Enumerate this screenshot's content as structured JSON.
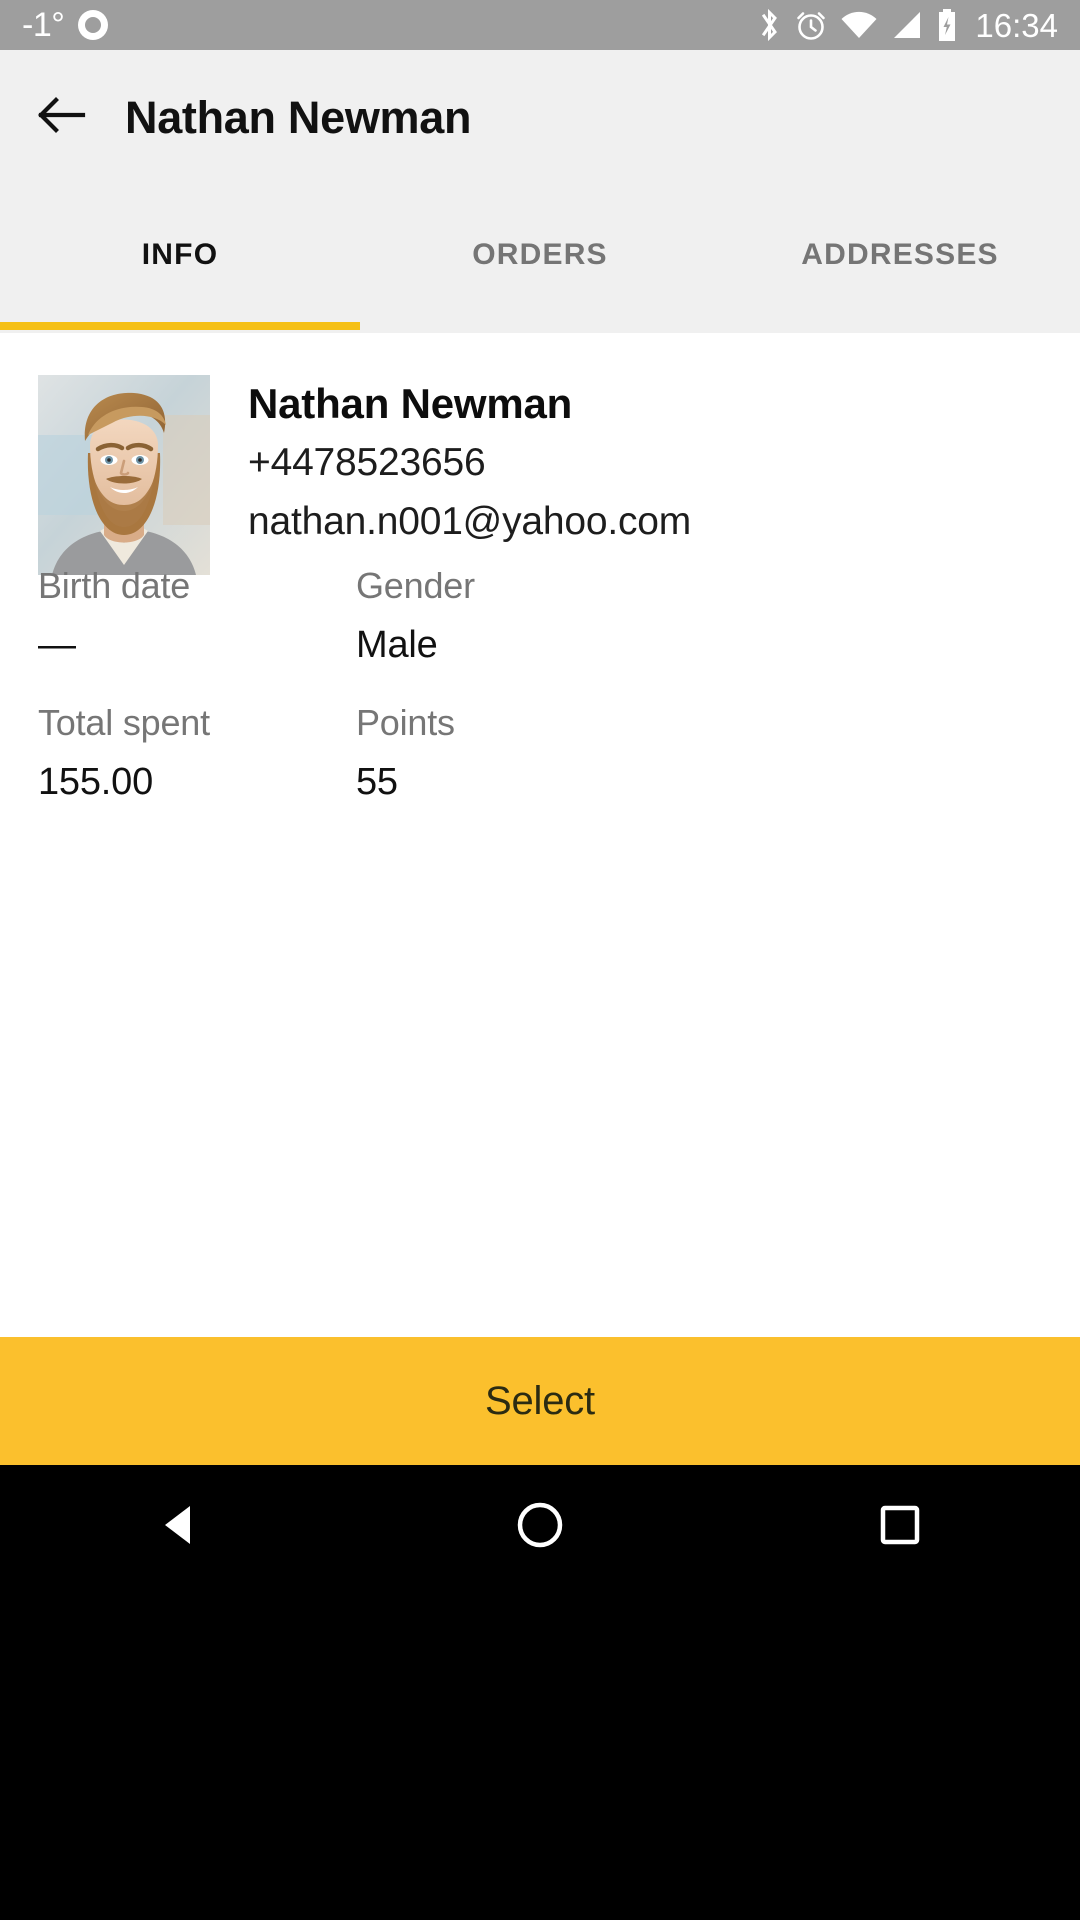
{
  "status_bar": {
    "temperature": "-1°",
    "left_icon": "donut-icon",
    "icons": [
      "bluetooth-icon",
      "alarm-icon",
      "wifi-icon",
      "signal-icon",
      "battery-charging-icon"
    ],
    "time": "16:34",
    "background_color": "#9e9e9e"
  },
  "app_bar": {
    "back_icon": "back-arrow-icon",
    "title": "Nathan Newman",
    "background_color": "#f0f0f0"
  },
  "tabs": {
    "items": [
      {
        "label": "INFO",
        "active": true
      },
      {
        "label": "ORDERS",
        "active": false
      },
      {
        "label": "ADDRESSES",
        "active": false
      }
    ],
    "indicator_color": "#f5c016",
    "active_text_color": "#111111",
    "inactive_text_color": "#757575"
  },
  "profile": {
    "avatar": "customer-photo",
    "name": "Nathan Newman",
    "phone": "+4478523656",
    "email": "nathan.n001@yahoo.com"
  },
  "details": [
    [
      {
        "label": "Birth date",
        "value": "—"
      },
      {
        "label": "Gender",
        "value": "Male"
      }
    ],
    [
      {
        "label": "Total spent",
        "value": "155.00"
      },
      {
        "label": "Points",
        "value": "55"
      }
    ]
  ],
  "bottom_action": {
    "label": "Select",
    "background_color": "#fbc02d",
    "text_color": "#2b2b12"
  },
  "nav_bar": {
    "items": [
      "back-triangle-icon",
      "home-circle-icon",
      "recents-square-icon"
    ],
    "background_color": "#000000"
  }
}
